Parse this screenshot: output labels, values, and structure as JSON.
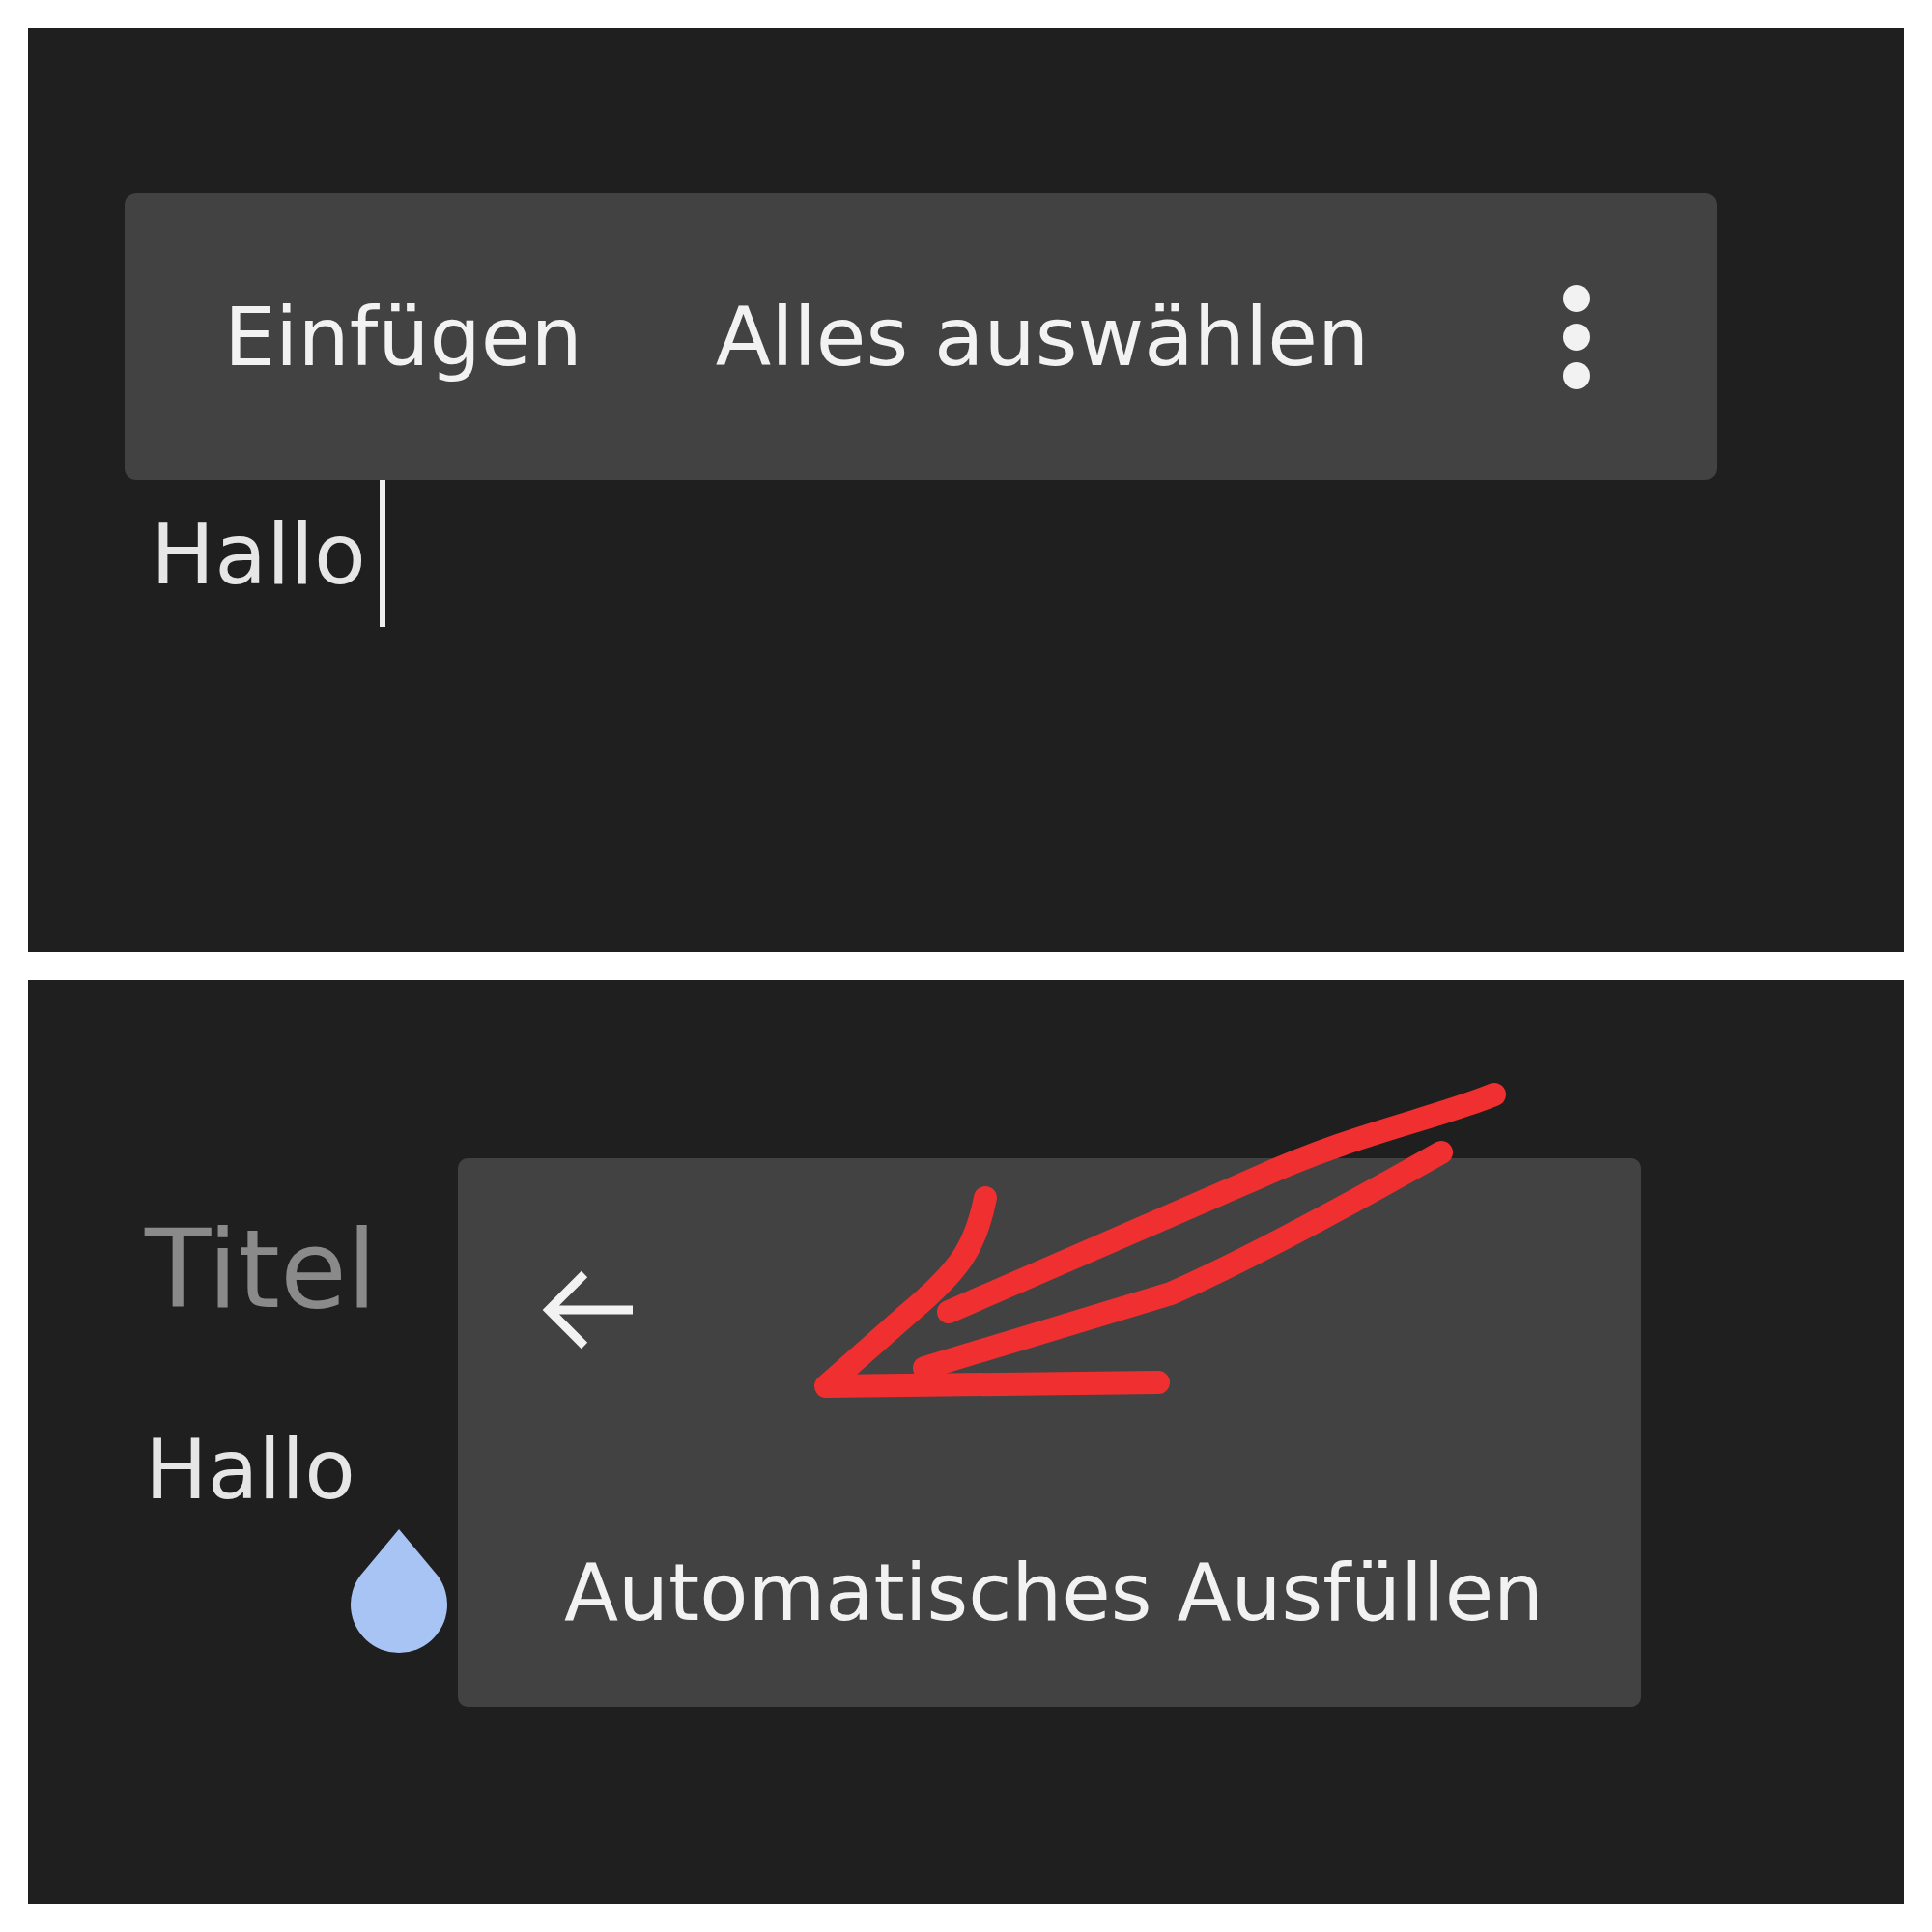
{
  "top_screen": {
    "toolbar": [
      {
        "label": "Einfügen"
      },
      {
        "label": "Alles auswählen"
      }
    ],
    "text": "Hallo"
  },
  "bottom_screen": {
    "title": {
      "placeholder": "Titel"
    },
    "text": "Hallo",
    "popup": {
      "label": "Automatisches Ausfüllen"
    }
  }
}
